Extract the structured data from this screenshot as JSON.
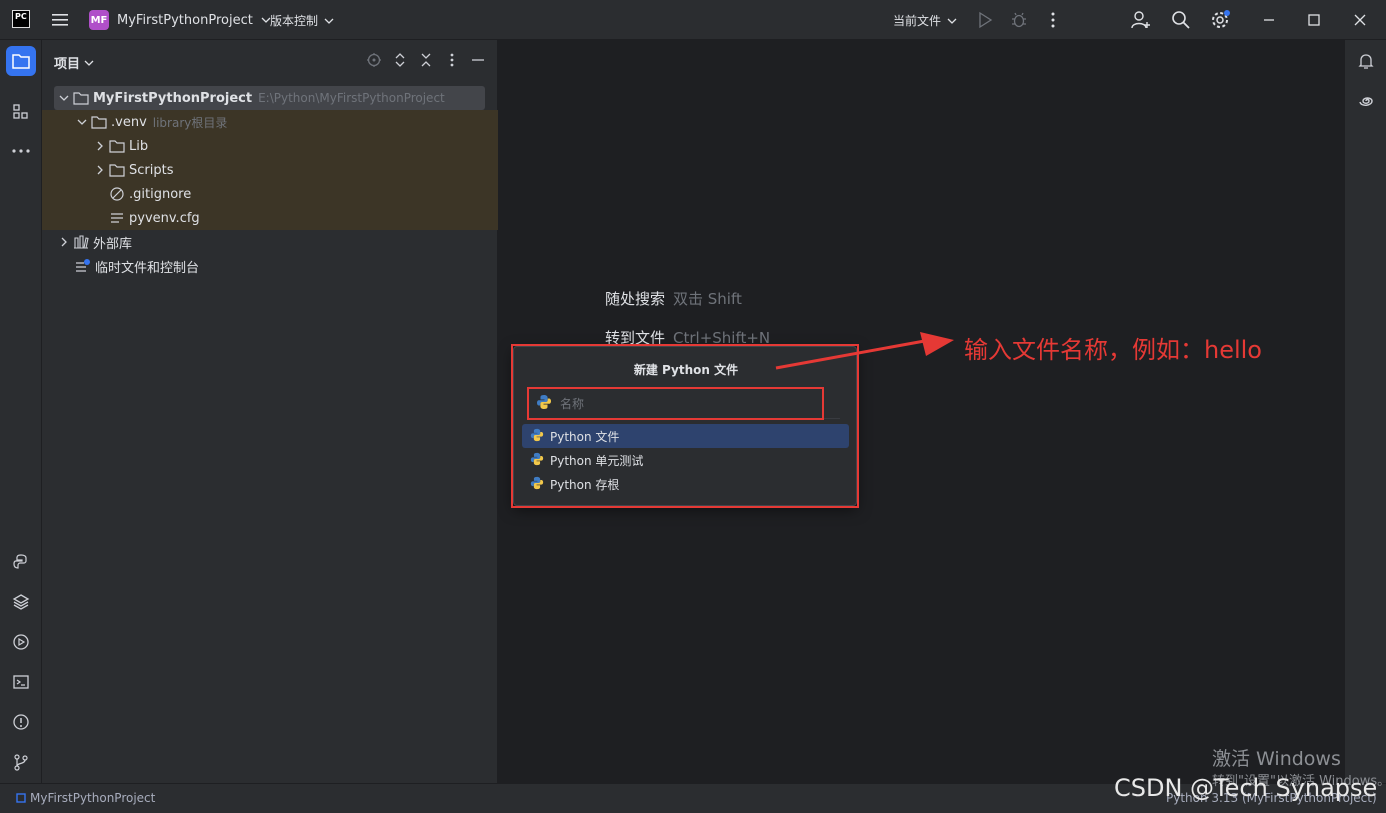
{
  "titlebar": {
    "app_logo": "PC",
    "project_badge": "MF",
    "project_name": "MyFirstPythonProject",
    "vcs_label": "版本控制",
    "run_config": "当前文件"
  },
  "project_panel": {
    "title": "项目",
    "tree": [
      {
        "label": "MyFirstPythonProject",
        "hint": "E:\\Python\\MyFirstPythonProject"
      },
      {
        "label": ".venv",
        "hint": "library根目录"
      },
      {
        "label": "Lib"
      },
      {
        "label": "Scripts"
      },
      {
        "label": ".gitignore"
      },
      {
        "label": "pyvenv.cfg"
      },
      {
        "label": "外部库"
      },
      {
        "label": "临时文件和控制台"
      }
    ]
  },
  "editor": {
    "hint_search": "随处搜索",
    "hint_search_key": "双击 Shift",
    "hint_goto": "转到文件",
    "hint_goto_key": "Ctrl+Shift+N"
  },
  "popup": {
    "title": "新建 Python 文件",
    "name_placeholder": "名称",
    "items": [
      "Python 文件",
      "Python 单元测试",
      "Python 存根"
    ]
  },
  "annotation": {
    "text": "输入文件名称，例如：hello",
    "color": "#e53935"
  },
  "statusbar": {
    "project": "MyFirstPythonProject",
    "interpreter": "Python 3.13 (MyFirstPythonProject)"
  },
  "watermarks": {
    "windows_title": "激活 Windows",
    "windows_sub": "转到\"设置\"以激活 Windows。",
    "csdn": "CSDN @Tech Synapse"
  },
  "colors": {
    "accent": "#3574f0",
    "selection": "#2e436e",
    "excluded_bg": "#3c3526",
    "editor_bg": "#1e1f22",
    "panel_bg": "#2b2d30"
  }
}
